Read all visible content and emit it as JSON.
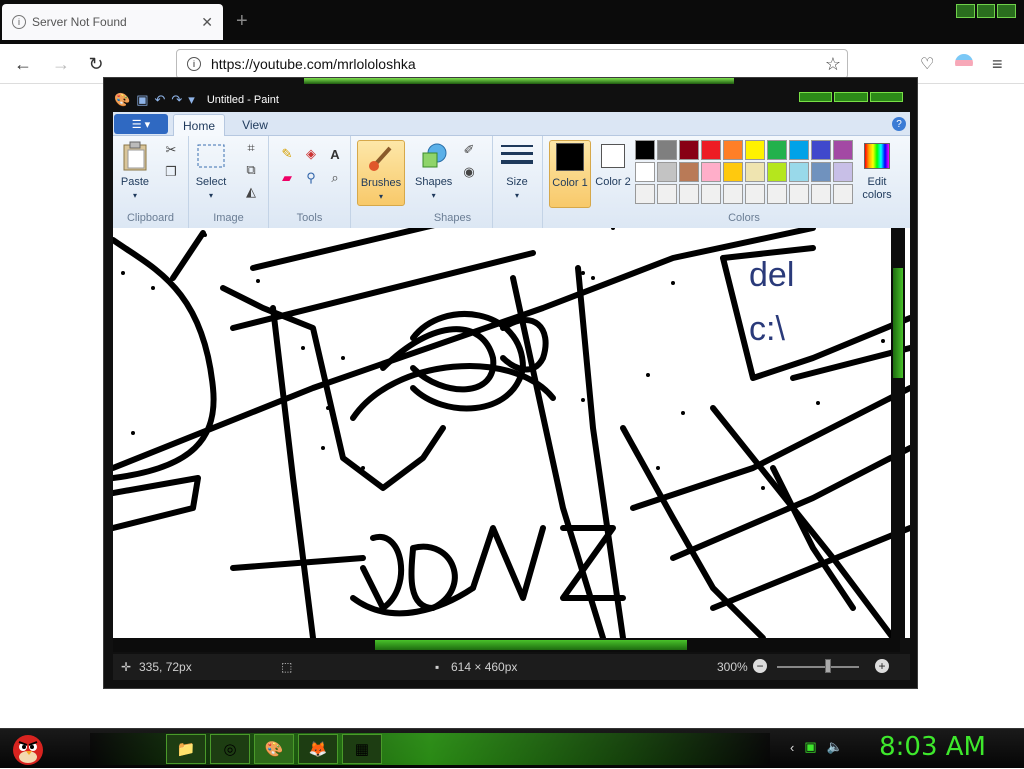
{
  "browser": {
    "tab_title": "Server Not Found",
    "new_tab_symbol": "+",
    "url": "https://youtube.com/mrlololoshka"
  },
  "paint": {
    "window_title": "Untitled - Paint",
    "tabs": [
      "Home",
      "View"
    ],
    "groups": {
      "clipboard": {
        "label": "Clipboard",
        "paste": "Paste"
      },
      "image": {
        "label": "Image",
        "select": "Select"
      },
      "tools": {
        "label": "Tools"
      },
      "brushes": {
        "label": "Brushes"
      },
      "shapes": {
        "label": "Shapes",
        "shapes_btn": "Shapes"
      },
      "size": {
        "label": "Size"
      },
      "colors": {
        "label": "Colors",
        "color1": "Color 1",
        "color2": "Color 2",
        "edit": "Edit colors",
        "color1_value": "#000000",
        "color2_value": "#ffffff",
        "palette": [
          "#000000",
          "#7f7f7f",
          "#880015",
          "#ed1c24",
          "#ff7f27",
          "#fff200",
          "#22b14c",
          "#00a2e8",
          "#3f48cc",
          "#a349a4",
          "#ffffff",
          "#c3c3c3",
          "#b97a57",
          "#ffaec9",
          "#ffc90e",
          "#efe4b0",
          "#b5e61d",
          "#99d9ea",
          "#7092be",
          "#c8bfe7",
          "#f0f0f0",
          "#f0f0f0",
          "#f0f0f0",
          "#f0f0f0",
          "#f0f0f0",
          "#f0f0f0",
          "#f0f0f0",
          "#f0f0f0",
          "#f0f0f0",
          "#f0f0f0"
        ]
      }
    },
    "canvas_text": {
      "line1": "del",
      "line2": "c:\\",
      "scribble": "BONZI"
    },
    "status": {
      "cursor_pos": "335, 72px",
      "image_size": "614 × 460px",
      "zoom": "300%",
      "zoom_level_percent": 300
    }
  },
  "taskbar": {
    "clock": "8:03 AM",
    "apps": [
      "file-explorer-icon",
      "chrome-icon",
      "paint-icon",
      "firefox-icon",
      "control-panel-icon"
    ]
  }
}
